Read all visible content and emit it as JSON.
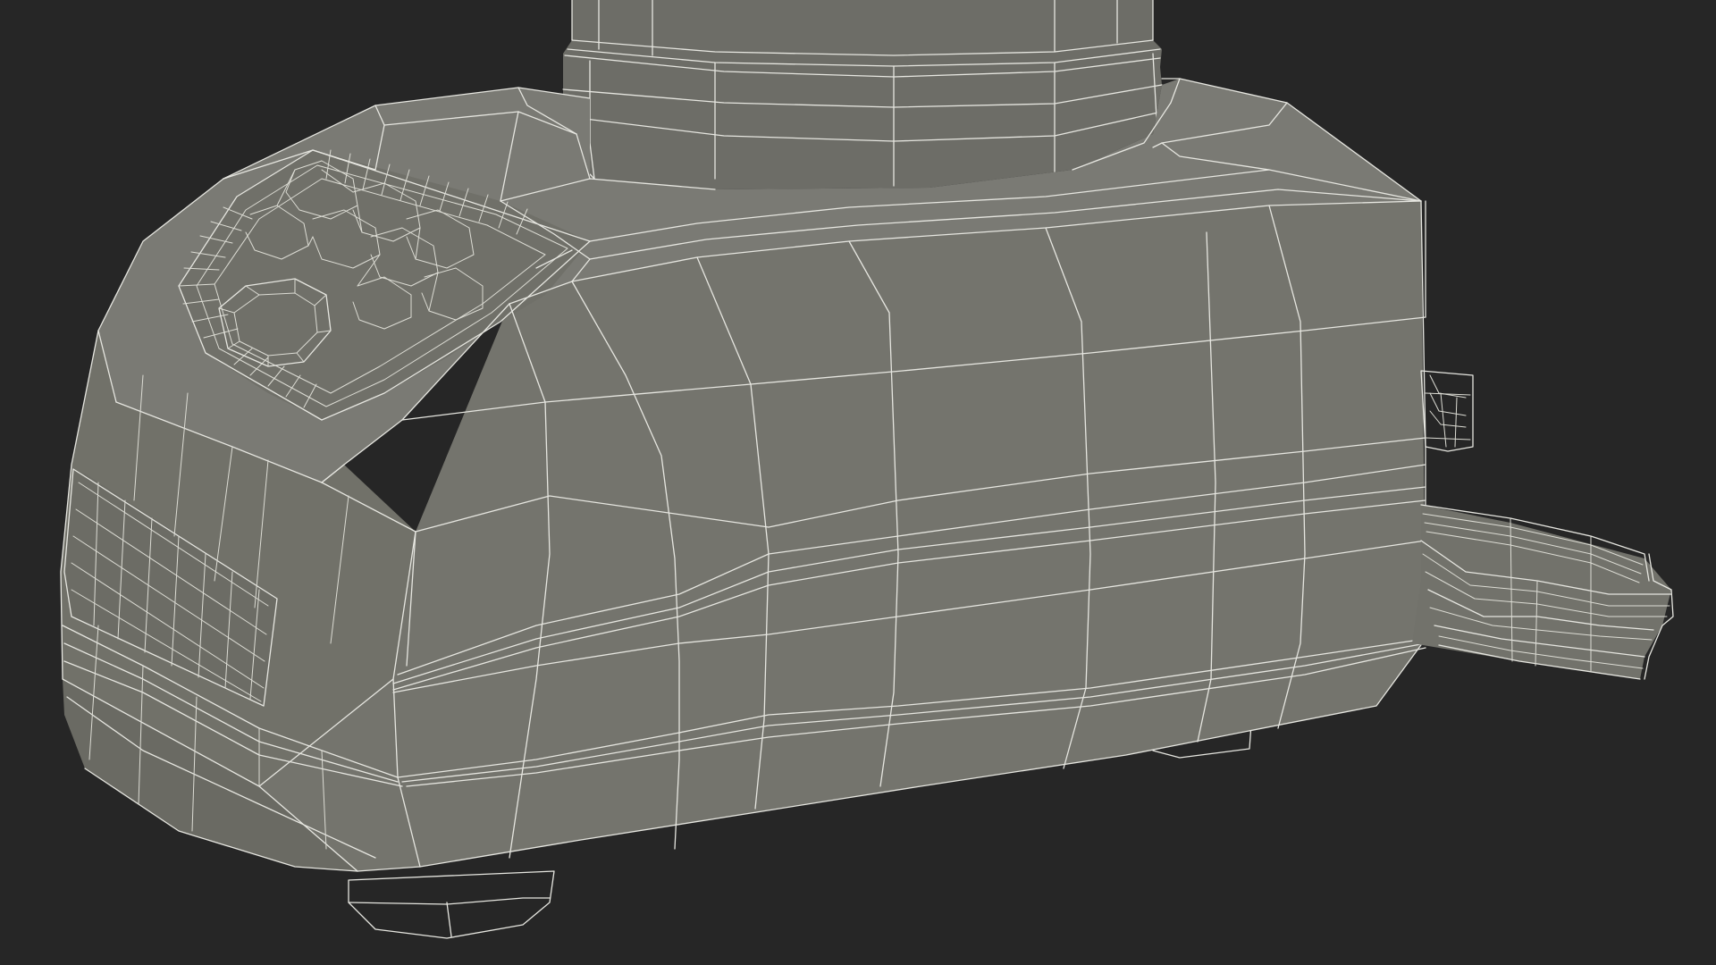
{
  "scene": {
    "background_color": "#262626",
    "surface_color": "#767670",
    "surface_shadow_color": "#66665f",
    "surface_light_color": "#808079",
    "wireframe_color": "#e6e6e0",
    "object": "blender-base-wireframe"
  }
}
